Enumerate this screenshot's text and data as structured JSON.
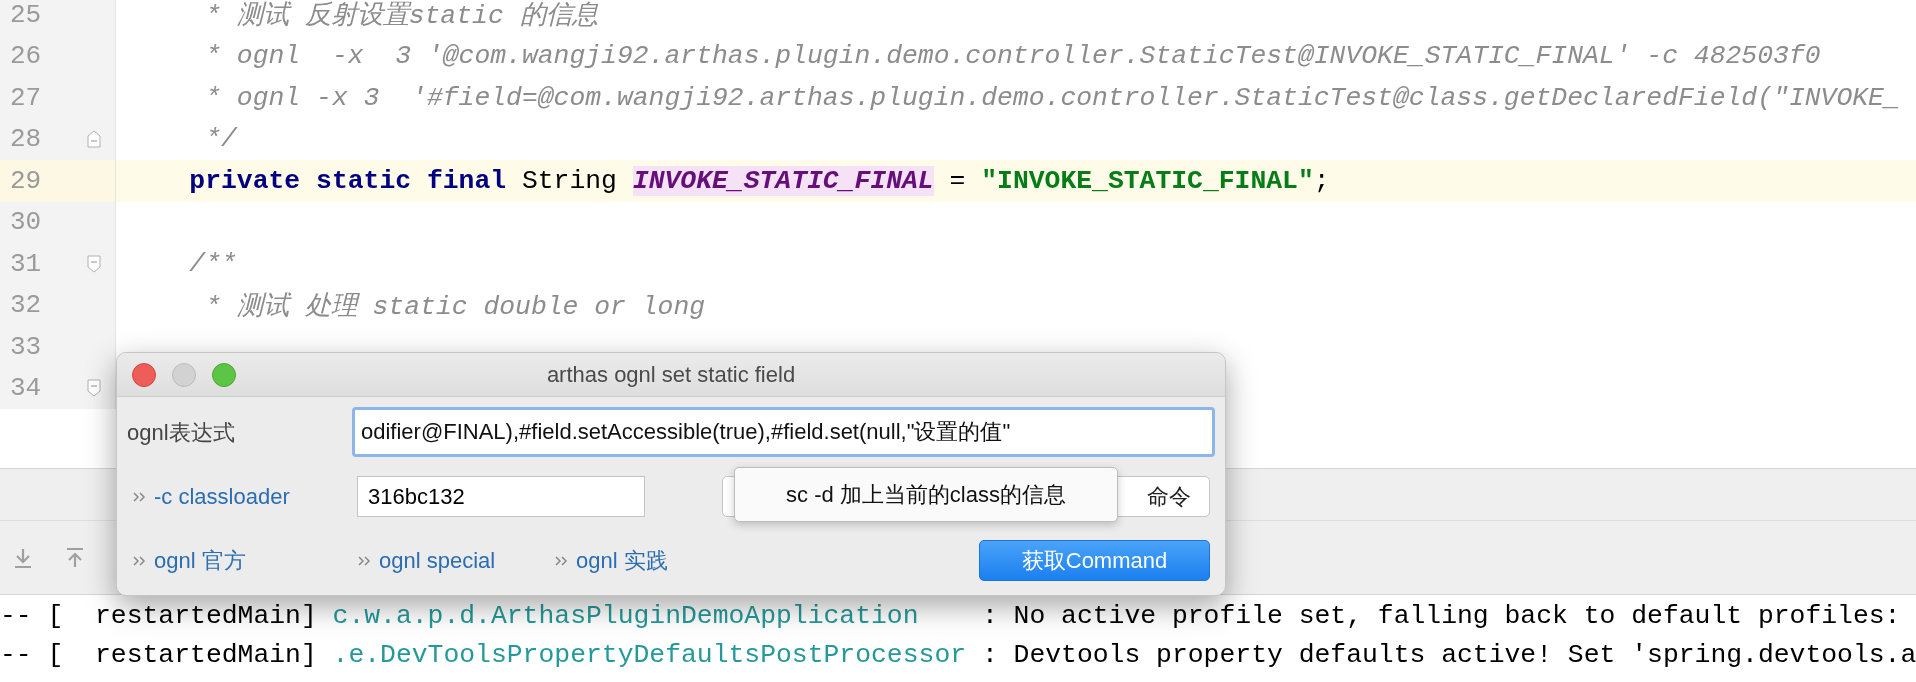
{
  "editor": {
    "lines": [
      {
        "number": "25",
        "current": false,
        "fold_start": false,
        "fold_end": false,
        "segments": [
          {
            "kind": "comment",
            "text": "     * 测试 反射设置static 的信息"
          }
        ]
      },
      {
        "number": "26",
        "current": false,
        "fold_start": false,
        "fold_end": false,
        "segments": [
          {
            "kind": "comment",
            "text": "     * ognl  -x  3 '@com.wangji92.arthas.plugin.demo.controller.StaticTest@INVOKE_STATIC_FINAL' -c 482503f0"
          }
        ]
      },
      {
        "number": "27",
        "current": false,
        "fold_start": false,
        "fold_end": false,
        "segments": [
          {
            "kind": "comment",
            "text": "     * ognl -x 3  '#field=@com.wangji92.arthas.plugin.demo.controller.StaticTest@class.getDeclaredField(\"INVOKE_"
          }
        ]
      },
      {
        "number": "28",
        "current": false,
        "fold_start": false,
        "fold_end": true,
        "segments": [
          {
            "kind": "comment",
            "text": "     */"
          }
        ]
      },
      {
        "number": "29",
        "current": true,
        "fold_start": false,
        "fold_end": false,
        "segments": [
          {
            "kind": "keyword",
            "text": "    private static final "
          },
          {
            "kind": "plain",
            "text": "String "
          },
          {
            "kind": "constant",
            "text": "INVOKE_STATIC_FINAL"
          },
          {
            "kind": "plain",
            "text": " = "
          },
          {
            "kind": "string",
            "text": "\"INVOKE_STATIC_FINAL\""
          },
          {
            "kind": "plain",
            "text": ";"
          }
        ]
      },
      {
        "number": "30",
        "current": false,
        "fold_start": false,
        "fold_end": false
      },
      {
        "number": "31",
        "current": false,
        "fold_start": true,
        "fold_end": false,
        "segments": [
          {
            "kind": "comment",
            "text": "    /**"
          }
        ]
      },
      {
        "number": "32",
        "current": false,
        "fold_start": false,
        "fold_end": false,
        "segments": [
          {
            "kind": "comment",
            "text": "     * 测试 处理 static double or long"
          }
        ]
      },
      {
        "number": "33",
        "current": false,
        "fold_start": false,
        "fold_end": false
      },
      {
        "number": "34",
        "current": false,
        "fold_start": true,
        "fold_end": false
      }
    ]
  },
  "dialog": {
    "title": "arthas ognl set static field",
    "expression_label": "ognl表达式",
    "expression_value": "odifier@FINAL),#field.setAccessible(true),#field.set(null,\"设置的值\"",
    "classloader_link": "-c classloader",
    "classloader_value": "316bc132",
    "command_button": "命令",
    "tooltip": "sc -d 加上当前的class的信息",
    "links": [
      "ognl 官方",
      "ognl special",
      "ognl 实践"
    ],
    "submit_button": "获取Command"
  },
  "console": {
    "lines": [
      {
        "segments": [
          {
            "kind": "plain",
            "text": "-- [  restartedMain] "
          },
          {
            "kind": "logger",
            "text": "c.w.a.p.d.ArthasPluginDemoApplication"
          },
          {
            "kind": "plain",
            "text": "    : No active profile set, falling back to default profiles:"
          }
        ]
      },
      {
        "segments": [
          {
            "kind": "plain",
            "text": "-- [  restartedMain] "
          },
          {
            "kind": "logger",
            "text": ".e.DevToolsPropertyDefaultsPostProcessor"
          },
          {
            "kind": "plain",
            "text": " : Devtools property defaults active! Set 'spring.devtools.a"
          }
        ]
      }
    ]
  }
}
